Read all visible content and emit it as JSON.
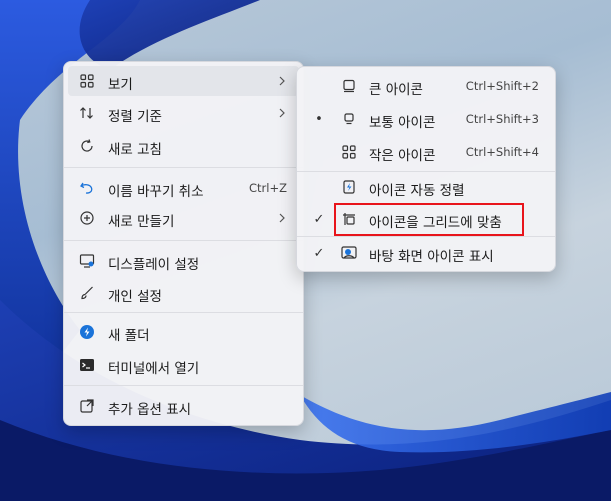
{
  "context_menu": {
    "items": [
      {
        "label": "보기",
        "icon": "view-grid-icon",
        "has_submenu": true
      },
      {
        "label": "정렬 기준",
        "icon": "sort-arrows-icon",
        "has_submenu": true
      },
      {
        "label": "새로 고침",
        "icon": "refresh-icon"
      },
      {
        "label": "이름 바꾸기 취소",
        "icon": "undo-icon",
        "shortcut": "Ctrl+Z"
      },
      {
        "label": "새로 만들기",
        "icon": "add-circle-icon",
        "has_submenu": true
      },
      {
        "label": "디스플레이 설정",
        "icon": "monitor-settings-icon"
      },
      {
        "label": "개인 설정",
        "icon": "brush-icon"
      },
      {
        "label": "새 폴더",
        "icon": "new-folder-icon"
      },
      {
        "label": "터미널에서 열기",
        "icon": "terminal-icon"
      },
      {
        "label": "추가 옵션 표시",
        "icon": "open-external-icon"
      }
    ]
  },
  "view_submenu": {
    "items": [
      {
        "label": "큰 아이콘",
        "icon": "large-icons-icon",
        "shortcut": "Ctrl+Shift+2",
        "mark": ""
      },
      {
        "label": "보통 아이콘",
        "icon": "medium-icons-icon",
        "shortcut": "Ctrl+Shift+3",
        "mark": "•"
      },
      {
        "label": "작은 아이콘",
        "icon": "small-icons-icon",
        "shortcut": "Ctrl+Shift+4",
        "mark": ""
      },
      {
        "label": "아이콘 자동 정렬",
        "icon": "auto-arrange-icon",
        "mark": ""
      },
      {
        "label": "아이콘을 그리드에 맞춤",
        "icon": "align-grid-icon",
        "mark": "✓"
      },
      {
        "label": "바탕 화면 아이콘 표시",
        "icon": "show-desktop-icons-icon",
        "mark": "✓"
      }
    ]
  },
  "colors": {
    "highlight_border": "#e8141b",
    "accent": "#1a73d9"
  }
}
